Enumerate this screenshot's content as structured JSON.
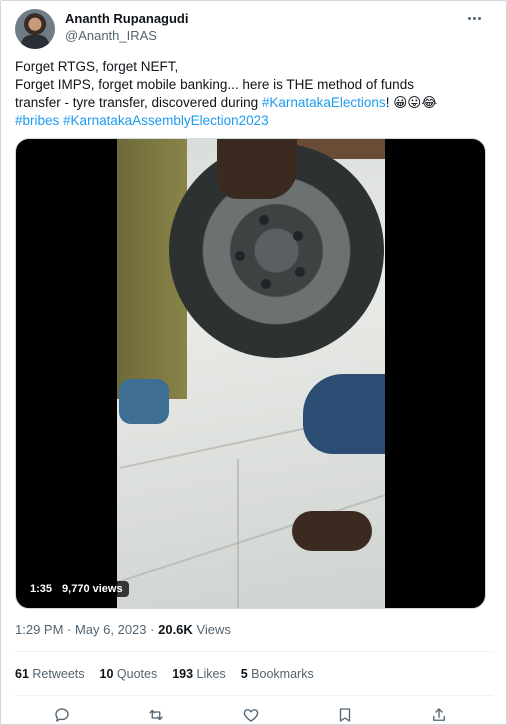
{
  "author": {
    "display_name": "Ananth Rupanagudi",
    "handle": "@Ananth_IRAS"
  },
  "tweet": {
    "line1": "Forget RTGS, forget NEFT,",
    "line2": "Forget IMPS, forget mobile banking... here is THE method of funds",
    "line3_prefix": "transfer - tyre transfer, discovered during ",
    "hashtag_karnataka_elections": "#KarnatakaElections",
    "line3_suffix": "! 😀😛😂",
    "hashtag_bribes": "#bribes",
    "hashtag_assembly": "#KarnatakaAssemblyElection2023"
  },
  "video": {
    "duration": "1:35",
    "views": "9,770 views"
  },
  "meta": {
    "timestamp": "1:29 PM · May 6, 2023",
    "separator": "·",
    "views_count": "20.6K",
    "views_label": "Views"
  },
  "stats": {
    "retweets_count": "61",
    "retweets_label": "Retweets",
    "quotes_count": "10",
    "quotes_label": "Quotes",
    "likes_count": "193",
    "likes_label": "Likes",
    "bookmarks_count": "5",
    "bookmarks_label": "Bookmarks"
  },
  "icons": {
    "more": "more-icon",
    "reply": "reply-icon",
    "retweet": "retweet-icon",
    "like": "heart-icon",
    "bookmark": "bookmark-icon",
    "share": "share-icon"
  },
  "colors": {
    "link": "#1d9bf0",
    "text": "#0f1419",
    "muted": "#536471",
    "border": "#cfd9de"
  }
}
